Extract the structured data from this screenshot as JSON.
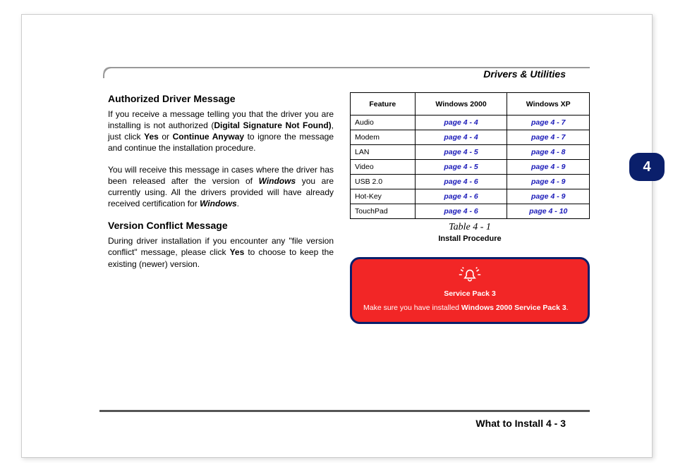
{
  "header": {
    "section": "Drivers & Utilities",
    "chapter_tab": "4"
  },
  "left": {
    "h1": "Authorized Driver Message",
    "p1a": "If you receive a message telling you that the driver you are installing is not authorized (",
    "p1b": "Digital Signature Not Found)",
    "p1c": ", just click ",
    "p1d": "Yes",
    "p1e": " or ",
    "p1f": "Continue Anyway",
    "p1g": " to ignore the message and continue the installation procedure.",
    "p2a": "You will receive this message in cases where the driver has been released after the version of ",
    "p2b": "Windows",
    "p2c": " you are currently using. All the drivers provided will have already received certification for ",
    "p2d": "Windows",
    "p2e": ".",
    "h2": "Version Conflict Message",
    "p3a": "During driver installation if you encounter any \"file version conflict\" message, please click ",
    "p3b": "Yes",
    "p3c": " to choose to keep the existing (newer) version."
  },
  "table": {
    "headers": {
      "c1": "Feature",
      "c2": "Windows 2000",
      "c3": "Windows XP"
    },
    "rows": [
      {
        "feature": "Audio",
        "w2k": "page 4 - 4",
        "wxp": "page 4 - 7"
      },
      {
        "feature": "Modem",
        "w2k": "page 4 - 4",
        "wxp": "page 4 - 7"
      },
      {
        "feature": "LAN",
        "w2k": "page 4 - 5",
        "wxp": "page 4 - 8"
      },
      {
        "feature": "Video",
        "w2k": "page 4 - 5",
        "wxp": "page 4 - 9"
      },
      {
        "feature": "USB 2.0",
        "w2k": "page 4 - 6",
        "wxp": "page 4 - 9"
      },
      {
        "feature": "Hot-Key",
        "w2k": "page 4 - 6",
        "wxp": "page 4 - 9"
      },
      {
        "feature": "TouchPad",
        "w2k": "page 4 - 6",
        "wxp": "page 4 - 10"
      }
    ],
    "caption": "Table 4 - 1",
    "subcaption": "Install Procedure"
  },
  "warn": {
    "title": "Service Pack 3",
    "body_a": "Make sure you have installed ",
    "body_b": "Windows 2000 Service Pack 3",
    "body_c": "."
  },
  "footer": {
    "text": "What to Install  4  -  3"
  }
}
